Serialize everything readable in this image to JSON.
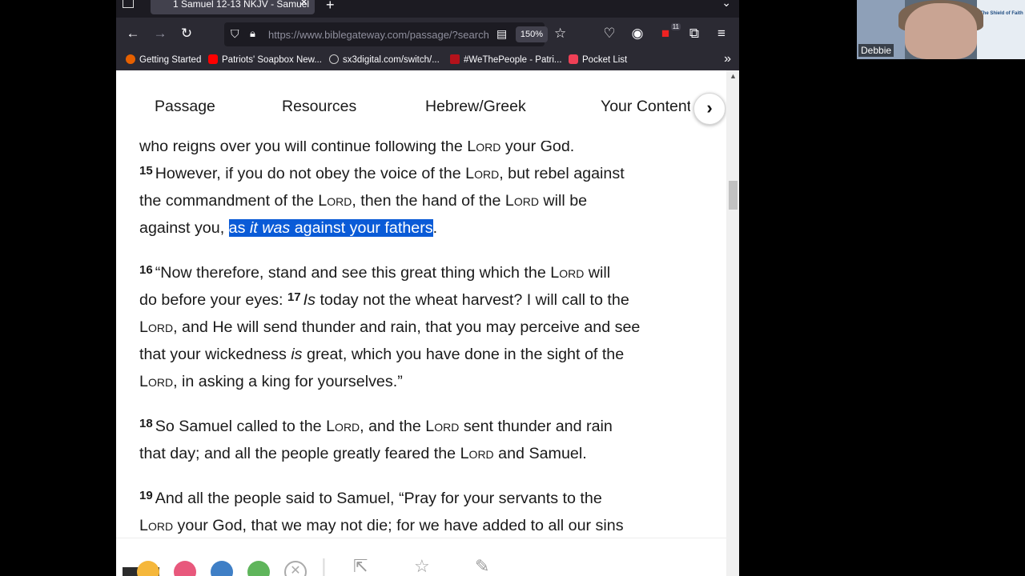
{
  "browser": {
    "tab_title": "1 Samuel 12-13 NKJV - Samuel",
    "url": "https://www.biblegateway.com/passage/?search",
    "zoom": "150%",
    "ext_badge": "11",
    "bookmarks": [
      {
        "label": "Getting Started",
        "color": "#e66000"
      },
      {
        "label": "Patriots' Soapbox New...",
        "color": "#ff0000"
      },
      {
        "label": "sx3digital.com/switch/...",
        "color": "#aaaaaa"
      },
      {
        "label": "#WeThePeople - Patri...",
        "color": "#b5121b"
      },
      {
        "label": "Pocket List",
        "color": "#ef4056"
      }
    ]
  },
  "page_tabs": [
    "Passage",
    "Resources",
    "Hebrew/Greek",
    "Your Content"
  ],
  "passage": {
    "l1_pre": "who reigns over you will continue following the ",
    "lord": "Lord",
    "l1_post": " your God.",
    "v15": "15",
    "l2_pre": "However, if you do not obey the voice of the ",
    "l2_post": ", but rebel against",
    "l3_pre": "the commandment of the ",
    "l3_mid": ", then the hand of the ",
    "l3_post": " will be",
    "l4_pre": "against you, ",
    "hl_1": "as ",
    "hl_2": "it was",
    "hl_3": " against your fathers",
    "l4_end": ".",
    "v16": "16",
    "l5_pre": "“Now therefore, stand and see this great thing which the ",
    "l5_post": " will",
    "l6_pre": "do before your eyes: ",
    "v17": "17",
    "l6_it": "Is",
    "l6_post": " today not the wheat harvest? I will call to the",
    "l7_post": ", and He will send thunder and rain, that you may perceive and see",
    "l8_pre": "that your wickedness ",
    "l8_it": "is",
    "l8_post": " great, which you have done in the sight of the",
    "l9_post": ", in asking a king for yourselves.”",
    "v18": "18",
    "l10_pre": "So Samuel called to the ",
    "l10_mid": ", and the ",
    "l10_post": " sent thunder and rain",
    "l11_pre": "that day; and all the people greatly feared the ",
    "l11_post": " and Samuel.",
    "v19": "19",
    "l12": "And all the people said to Samuel, “Pray for your servants to the",
    "l13_post": " your God, that we may not die; for we have added to all our sins"
  },
  "highlight_colors": [
    "#f5b73b",
    "#e8587c",
    "#3f7fc6",
    "#5fb55b"
  ],
  "webcam": {
    "name": "Debbie",
    "slide_title": "The Shield of Faith"
  }
}
